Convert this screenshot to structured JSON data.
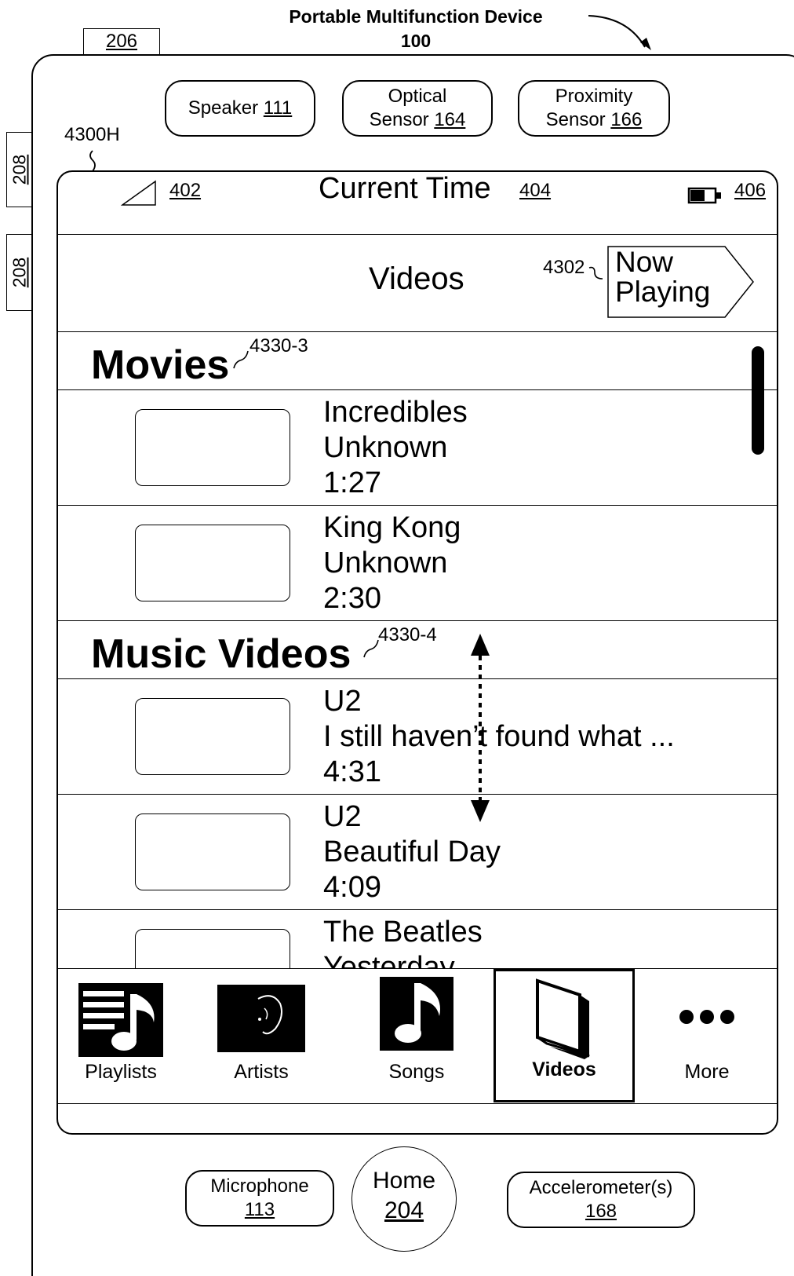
{
  "figure": {
    "title": "Portable Multifunction Device",
    "device_ref": "100",
    "ref_206": "206",
    "ref_208a": "208",
    "ref_208b": "208",
    "screen_ref": "4300H"
  },
  "hardware": {
    "speaker": {
      "label": "Speaker",
      "ref": "111"
    },
    "optical_sensor": {
      "label": "Optical",
      "label2": "Sensor",
      "ref": "164"
    },
    "proximity_sensor": {
      "label": "Proximity",
      "label2": "Sensor",
      "ref": "166"
    },
    "microphone": {
      "label": "Microphone",
      "ref": "113"
    },
    "home": {
      "label": "Home",
      "ref": "204"
    },
    "accelerometer": {
      "label": "Accelerometer(s)",
      "ref": "168"
    }
  },
  "status_bar": {
    "signal_ref": "402",
    "time_label": "Current Time",
    "time_ref": "404",
    "battery_ref": "406"
  },
  "nav_bar": {
    "title": "Videos",
    "now_playing_line1": "Now",
    "now_playing_line2": "Playing",
    "now_playing_ref": "4302"
  },
  "sections": [
    {
      "title": "Movies",
      "ref": "4330-3",
      "items": [
        {
          "line1": "Incredibles",
          "line2": "Unknown",
          "line3": "1:27"
        },
        {
          "line1": "King Kong",
          "line2": "Unknown",
          "line3": "2:30"
        }
      ]
    },
    {
      "title": "Music Videos",
      "ref": "4330-4",
      "items": [
        {
          "line1": "U2",
          "line2": "I still haven’t found what ...",
          "line3": "4:31"
        },
        {
          "line1": "U2",
          "line2": "Beautiful Day",
          "line3": "4:09"
        },
        {
          "line1": "The Beatles",
          "line2": "Yesterday",
          "line3": ""
        }
      ]
    }
  ],
  "tab_bar": {
    "tabs": [
      {
        "label": "Playlists",
        "icon": "playlist-icon",
        "selected": false
      },
      {
        "label": "Artists",
        "icon": "artist-icon",
        "selected": false
      },
      {
        "label": "Songs",
        "icon": "music-note-icon",
        "selected": false
      },
      {
        "label": "Videos",
        "icon": "tv-icon",
        "selected": true
      },
      {
        "label": "More",
        "icon": "more-dots-icon",
        "selected": false
      }
    ]
  }
}
